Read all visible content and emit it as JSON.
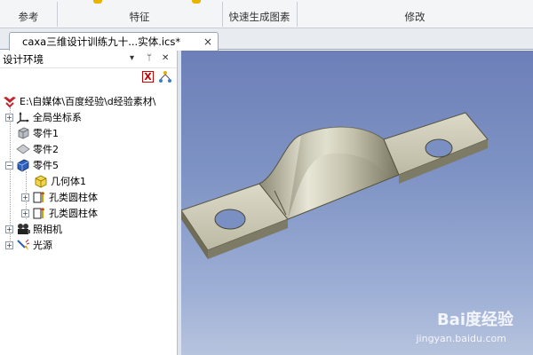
{
  "ribbon": {
    "groups": [
      "参考",
      "特征",
      "快速生成图素",
      "修改"
    ]
  },
  "document_tab": {
    "title": "caxa三维设计训练九十...实体.ics*",
    "close": "×"
  },
  "panel": {
    "title": "设计环境",
    "pin": "▾  ⊦  ×",
    "delete_icon": "X"
  },
  "tree": {
    "root": "E:\\自媒体\\百度经验\\d经验素材\\",
    "items": [
      {
        "label": "全局坐标系",
        "icon": "axes-icon"
      },
      {
        "label": "零件1",
        "icon": "part-gray-icon"
      },
      {
        "label": "零件2",
        "icon": "part-diamond-icon"
      },
      {
        "label": "零件5",
        "icon": "part-blue-icon"
      },
      {
        "label": "几何体1",
        "icon": "solid-yellow-icon"
      },
      {
        "label": "孔类圆柱体",
        "icon": "hole-cylinder-icon"
      },
      {
        "label": "孔类圆柱体",
        "icon": "hole-cylinder-icon"
      },
      {
        "label": "照相机",
        "icon": "camera-icon"
      },
      {
        "label": "光源",
        "icon": "light-icon"
      }
    ]
  },
  "watermark": {
    "brand": "Bai度经验",
    "url": "jingyan.baidu.com"
  }
}
